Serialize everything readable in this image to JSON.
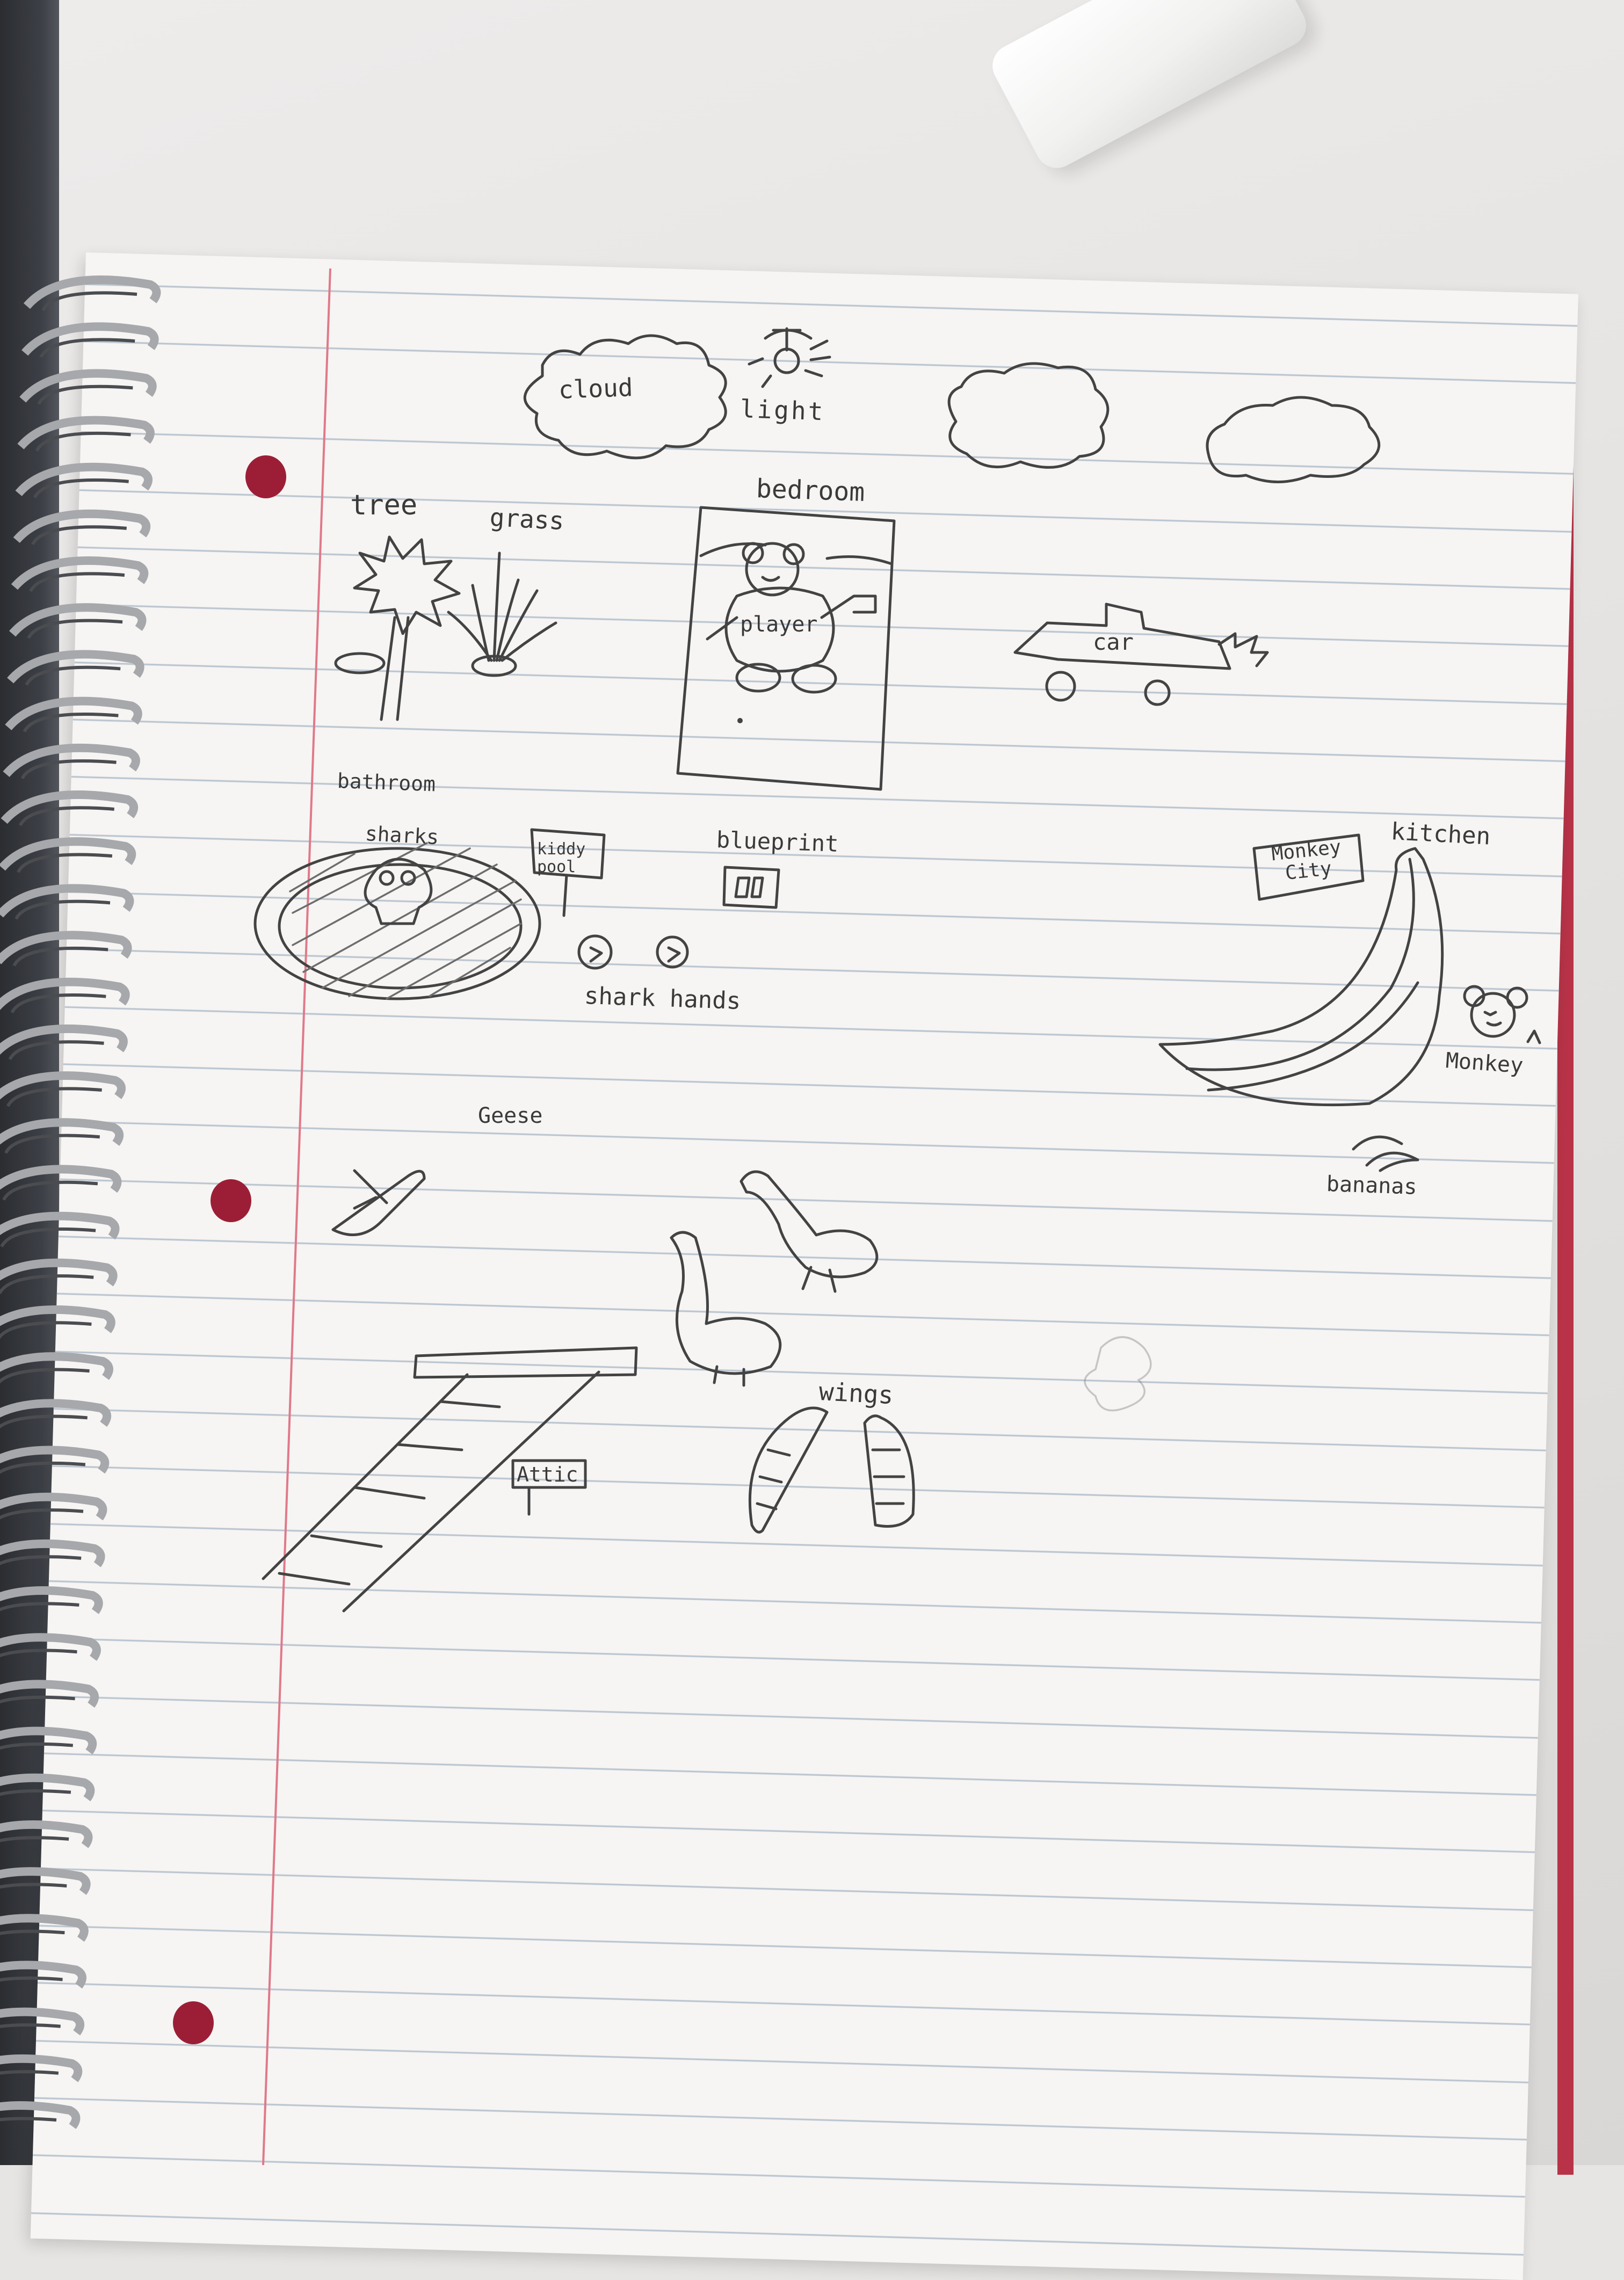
{
  "notebook_labels": {
    "cloud": "cloud",
    "light": "light",
    "bedroom": "bedroom",
    "tree": "tree",
    "grass": "grass",
    "player": "player",
    "car": "car",
    "bathroom": "bathroom",
    "sharks": "sharks",
    "kiddy_pool": "kiddy pool",
    "blueprint": "blueprint",
    "shark_hands": "shark hands",
    "monkey_city": "Monkey City",
    "kitchen": "kitchen",
    "monkey": "Monkey",
    "bananas": "bananas",
    "geese": "Geese",
    "wings": "wings",
    "attic": "Attic"
  },
  "colors": {
    "pencil": "#434343",
    "margin_line": "#e0798a",
    "rule_line": "#b9c4cf",
    "page": "#f6f5f3",
    "hole": "#9c1e36"
  }
}
